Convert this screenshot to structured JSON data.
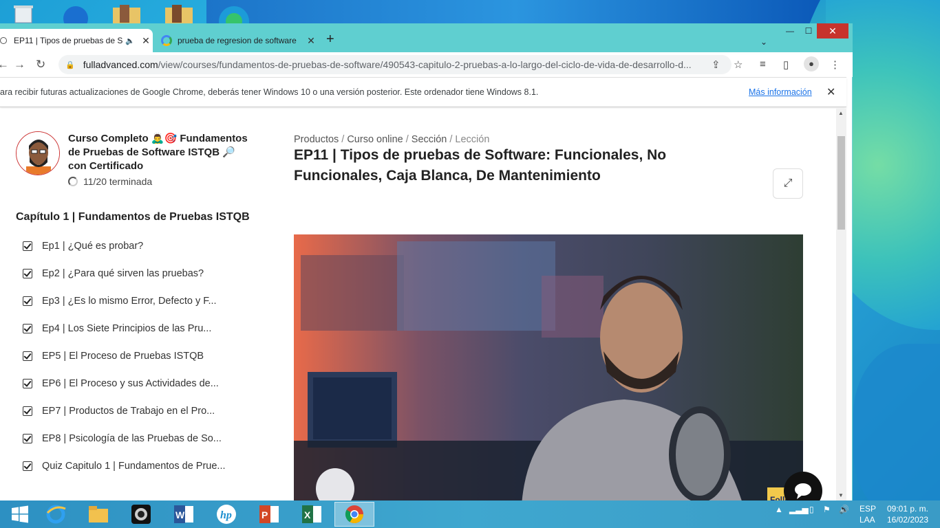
{
  "browser": {
    "tabs": [
      {
        "title": "EP11 | Tipos de pruebas de S",
        "active": true,
        "muted_icon": "speaker-icon"
      },
      {
        "title": "prueba de regresion de software",
        "active": false
      }
    ],
    "new_tab_label": "+",
    "url_host": "fulladvanced.com",
    "url_path": "/view/courses/fundamentos-de-pruebas-de-software/490543-capitulo-2-pruebas-a-lo-largo-del-ciclo-de-vida-de-desarrollo-d...",
    "infobar_message": "ara recibir futuras actualizaciones de Google Chrome, deberás tener Windows 10 o una versión posterior. Este ordenador tiene Windows 8.1.",
    "infobar_link": "Más información"
  },
  "sidebar": {
    "course_title": "Curso Completo 🙇‍♂️🎯 Fundamentos de Pruebas de Software ISTQB 🔎 con Certificado",
    "progress": "11/20 terminada",
    "chapter": "Capítulo 1 | Fundamentos de Pruebas ISTQB",
    "lessons": [
      "Ep1 | ¿Qué es probar?",
      "Ep2 | ¿Para qué sirven las pruebas?",
      "Ep3 | ¿Es lo mismo Error, Defecto y F...",
      "Ep4 | Los Siete Principios de las Pru...",
      "EP5 | El Proceso de Pruebas ISTQB",
      "EP6 | El Proceso y sus Actividades de...",
      "EP7 | Productos de Trabajo en el Pro...",
      "EP8 | Psicología de las Pruebas de So...",
      "Quiz Capitulo 1 | Fundamentos de Prue..."
    ]
  },
  "main": {
    "breadcrumb": [
      "Productos",
      "Curso online",
      "Sección",
      "Lección"
    ],
    "title": "EP11 | Tipos de pruebas de Software: Funcionales, No Funcionales, Caja Blanca, De Mantenimiento",
    "video_watermark": "Follo"
  },
  "taskbar": {
    "lang_top": "ESP",
    "lang_bottom": "LAA",
    "time": "09:01 p. m.",
    "date": "16/02/2023"
  },
  "colors": {
    "titlebar": "#5fcfd0",
    "close": "#c7332c",
    "link": "#1a73e8"
  }
}
